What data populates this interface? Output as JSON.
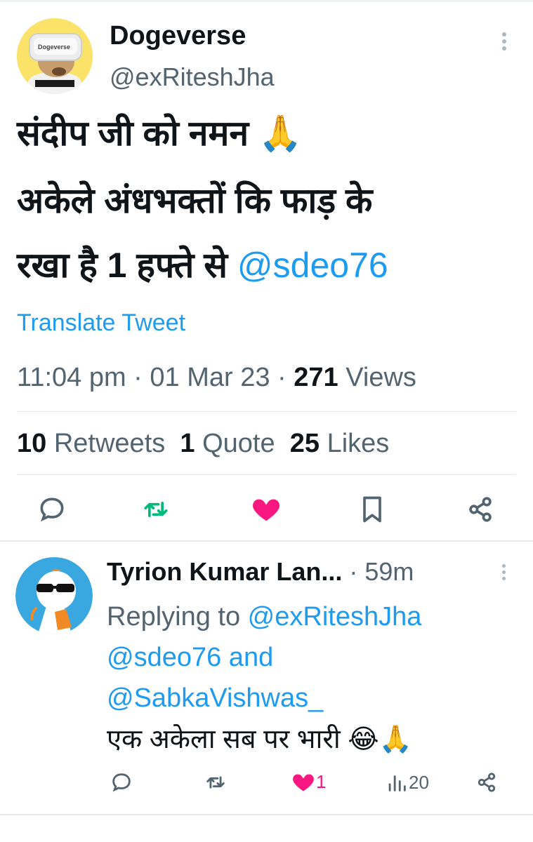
{
  "tweet": {
    "author_name": "Dogeverse",
    "author_handle": "@exRiteshJha",
    "avatar_text": "Dogeverse",
    "text_line1": "संदीप जी को नमन 🙏",
    "text_line2": "अकेले अंधभक्तों कि फाड़ के",
    "text_line3_plain": "रखा है 1 हफ्ते से ",
    "text_line3_mention": "@sdeo76",
    "translate_label": "Translate Tweet",
    "time": "11:04 pm",
    "sep1": " · ",
    "date": "01 Mar 23",
    "sep2": " · ",
    "views_count": "271",
    "views_label": " Views",
    "retweets_count": "10",
    "retweets_label": "Retweets",
    "quotes_count": "1",
    "quotes_label": "Quote",
    "likes_count": "25",
    "likes_label": "Likes"
  },
  "reply": {
    "author_name": "Tyrion Kumar Lan...",
    "sep": " · ",
    "time": "59m",
    "replying_label": "Replying to ",
    "mention1": "@exRiteshJha",
    "mention2": "@sdeo76",
    "and_label": " and",
    "mention3": "@SabkaVishwas_",
    "text": "एक अकेला सब पर भारी 😂🙏",
    "likes_count": "1",
    "views_count": "20"
  },
  "colors": {
    "accent": "#1d9bf0",
    "retweet_green": "#00ba7c",
    "like_pink": "#f91880",
    "muted": "#536471"
  },
  "icons": [
    "more-vertical-icon",
    "reply-icon",
    "retweet-icon",
    "heart-icon",
    "bookmark-icon",
    "share-icon",
    "views-icon"
  ]
}
